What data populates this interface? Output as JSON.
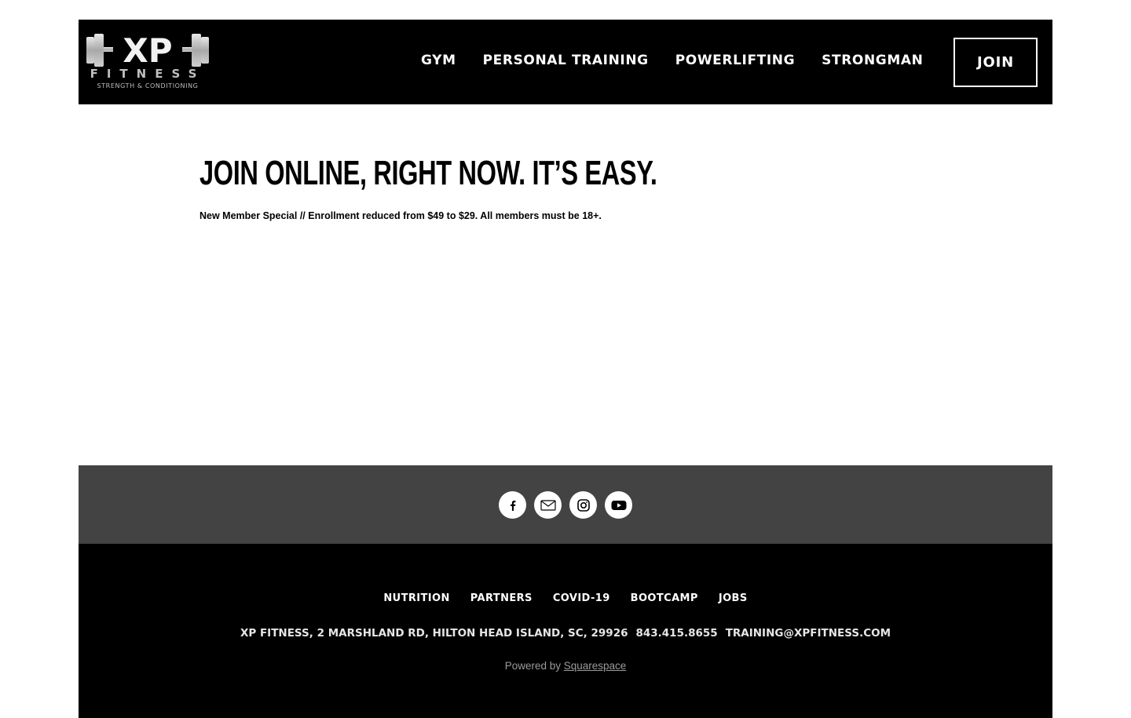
{
  "header": {
    "logo": {
      "letters": "XP",
      "subtitle": "FITNESS",
      "tagline": "STRENGTH & CONDITIONING",
      "icon": "dumbbell-logo-icon"
    },
    "nav": [
      {
        "label": "GYM"
      },
      {
        "label": "PERSONAL TRAINING"
      },
      {
        "label": "POWERLIFTING"
      },
      {
        "label": "STRONGMAN"
      }
    ],
    "join_label": "JOIN"
  },
  "main": {
    "title": "JOIN ONLINE, RIGHT NOW. IT’S EASY.",
    "promo": "New Member Special // Enrollment reduced from $49 to $29. All members must be 18+."
  },
  "social": {
    "icons": [
      "facebook-icon",
      "email-icon",
      "instagram-icon",
      "youtube-icon"
    ]
  },
  "footer": {
    "nav": [
      {
        "label": "NUTRITION"
      },
      {
        "label": "PARTNERS"
      },
      {
        "label": "COVID-19"
      },
      {
        "label": "BOOTCAMP"
      },
      {
        "label": "JOBS"
      }
    ],
    "address": "XP FITNESS, 2 MARSHLAND RD, HILTON HEAD ISLAND, SC, 29926",
    "phone": "843.415.8655",
    "email": "TRAINING@XPFITNESS.COM",
    "powered_prefix": "Powered by ",
    "powered_link": "Squarespace"
  },
  "colors": {
    "header_bg": "#000000",
    "social_bar_bg": "#434343",
    "footer_bg": "#000000",
    "text_light": "#ffffff"
  }
}
